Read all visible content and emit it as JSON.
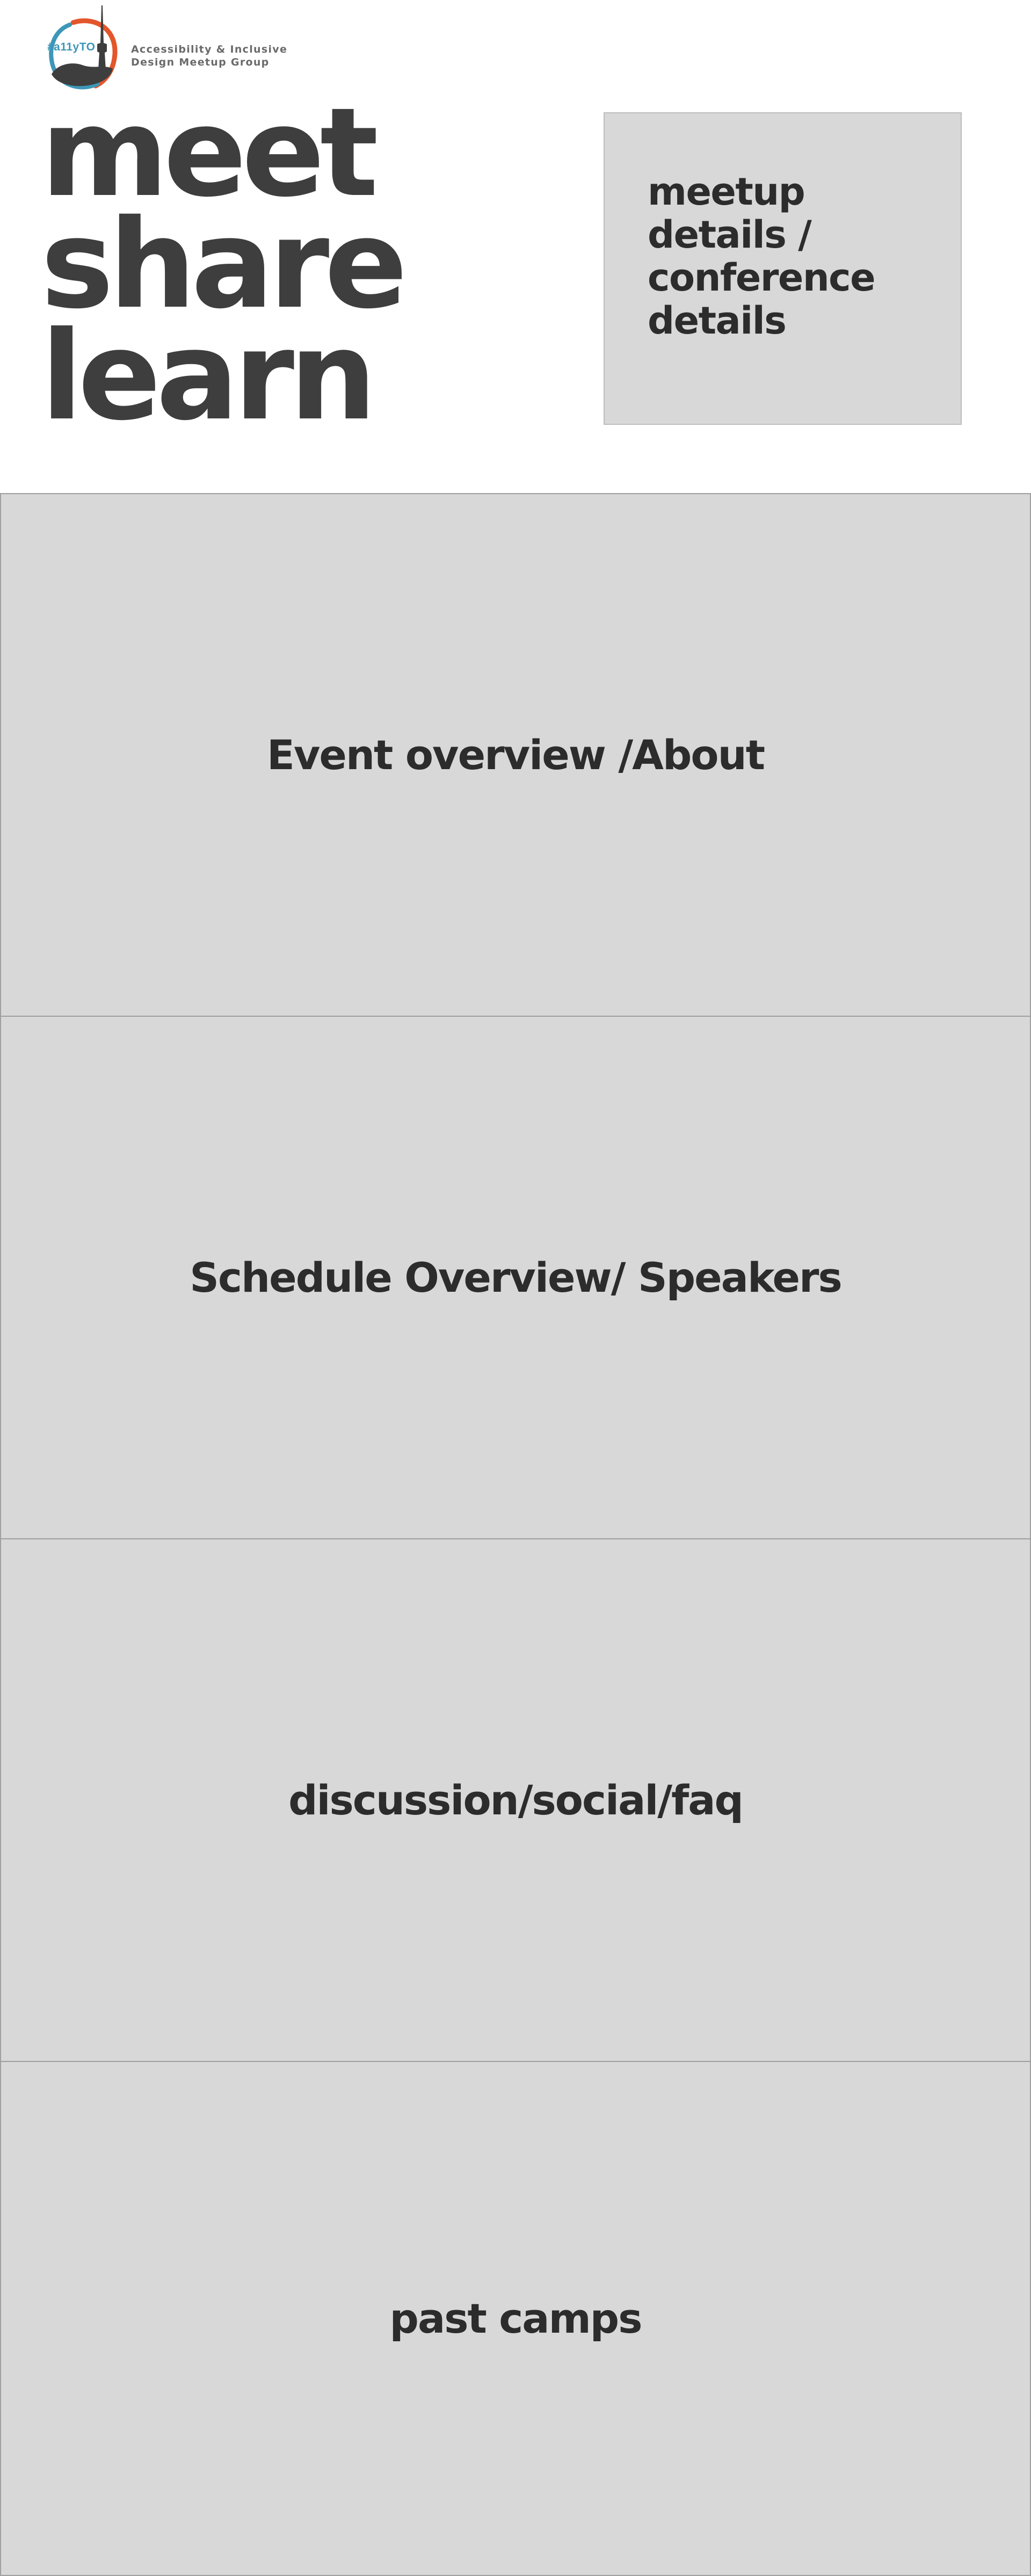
{
  "brand": {
    "badge": "#a11yTO",
    "tagline_line1": "Accessibility & Inclusive",
    "tagline_line2": "Design Meetup Group",
    "colors": {
      "badge_text": "#3d97b8",
      "swoosh_orange": "#e3562b",
      "swoosh_blue": "#3d97b8",
      "tower": "#3e3e3e"
    }
  },
  "hero": {
    "words": [
      "meet",
      "share",
      "learn"
    ],
    "details_card": "meetup details / conference details"
  },
  "sections": [
    {
      "label": "Event overview /About"
    },
    {
      "label": "Schedule Overview/ Speakers"
    },
    {
      "label": "discussion/social/faq"
    },
    {
      "label": "past camps"
    }
  ],
  "colors": {
    "page_bg": "#ffffff",
    "section_bg": "#d8d8d8",
    "section_border": "#9f9f9f",
    "heading_text": "#3e3e3e",
    "label_text": "#2c2c2c"
  }
}
